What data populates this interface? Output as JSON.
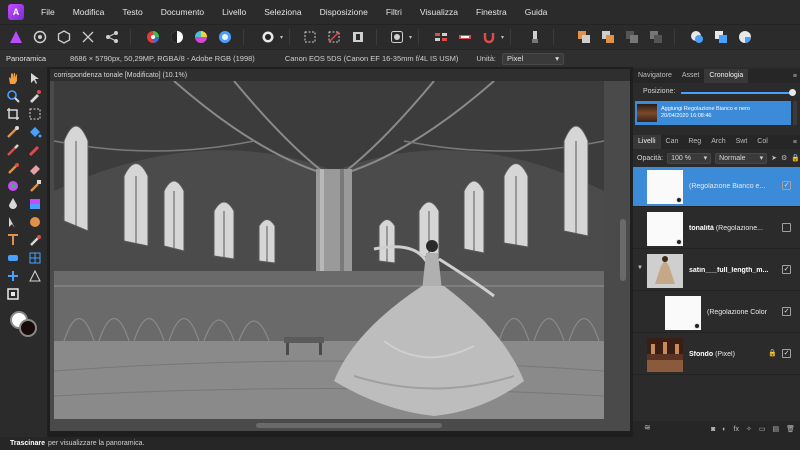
{
  "app": {
    "logo_glyph": "A",
    "accent": "#3b8bd9"
  },
  "menubar": {
    "items": [
      "File",
      "Modifica",
      "Testo",
      "Documento",
      "Livello",
      "Seleziona",
      "Disposizione",
      "Filtri",
      "Visualizza",
      "Finestra",
      "Guida"
    ]
  },
  "context_toolbar": {
    "tool_name": "Panoramica",
    "doc_info": "8686 × 5790px, 50,29MP, RGBA/8 - Adobe RGB (1998)",
    "camera": "Canon EOS 5DS (Canon EF 16-35mm f/4L IS USM)",
    "unit_label": "Unità:",
    "unit_value": "Pixel"
  },
  "document": {
    "tab_title": "corrispondenza tonale [Modificato] (10.1%)"
  },
  "history_panel": {
    "tabs": [
      "Navigatore",
      "Asset",
      "Cronologia"
    ],
    "active_tab": "Cronologia",
    "position_label": "Posizione:",
    "position_value": 1.0,
    "entry_title": "Aggiungi Regolazione Bianco e nero",
    "entry_date": "20/04/2020 16:08:46"
  },
  "layers_panel": {
    "tabs": [
      "Livelli",
      "Can",
      "Reg",
      "Arch",
      "Swt",
      "Col"
    ],
    "active_tab": "Livelli",
    "opacity_label": "Opacità:",
    "opacity_value": "100 %",
    "blend_mode": "Normale",
    "layers": [
      {
        "name": "(Regolazione Bianco e...",
        "bold": "",
        "selected": true,
        "checked": true,
        "locked": false
      },
      {
        "name": "(Regolazione...",
        "bold": "tonalità",
        "selected": false,
        "checked": false,
        "locked": false
      },
      {
        "name": "",
        "bold": "satin___full_length_m...",
        "selected": false,
        "checked": true,
        "locked": false
      },
      {
        "name": "(Regolazione Color",
        "bold": "",
        "selected": false,
        "checked": true,
        "locked": false
      },
      {
        "name": "(Pixel)",
        "bold": "Sfondo",
        "selected": false,
        "checked": true,
        "locked": true
      }
    ]
  },
  "statusbar": {
    "strong": "Trascinare",
    "rest": "per visualizzare la panoramica."
  }
}
